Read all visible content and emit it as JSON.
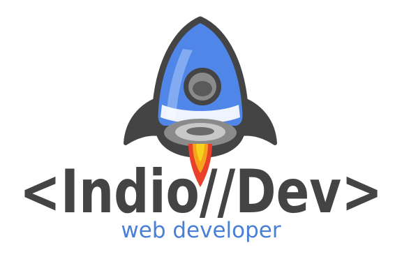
{
  "logo": {
    "wordmark": "<Indio//Dev>",
    "tagline": "web developer"
  },
  "colors": {
    "outline": "#444444",
    "rocket_blue": "#4f86e8",
    "rocket_blue_light": "#8cb2f2",
    "nozzle_grey": "#8a8a8a",
    "nozzle_light": "#c8c8c8",
    "flame_red": "#e8402a",
    "flame_orange": "#f7a21c",
    "flame_yellow": "#f7d21c",
    "tagline_blue": "#4a7fd8",
    "background": "#ffffff"
  }
}
